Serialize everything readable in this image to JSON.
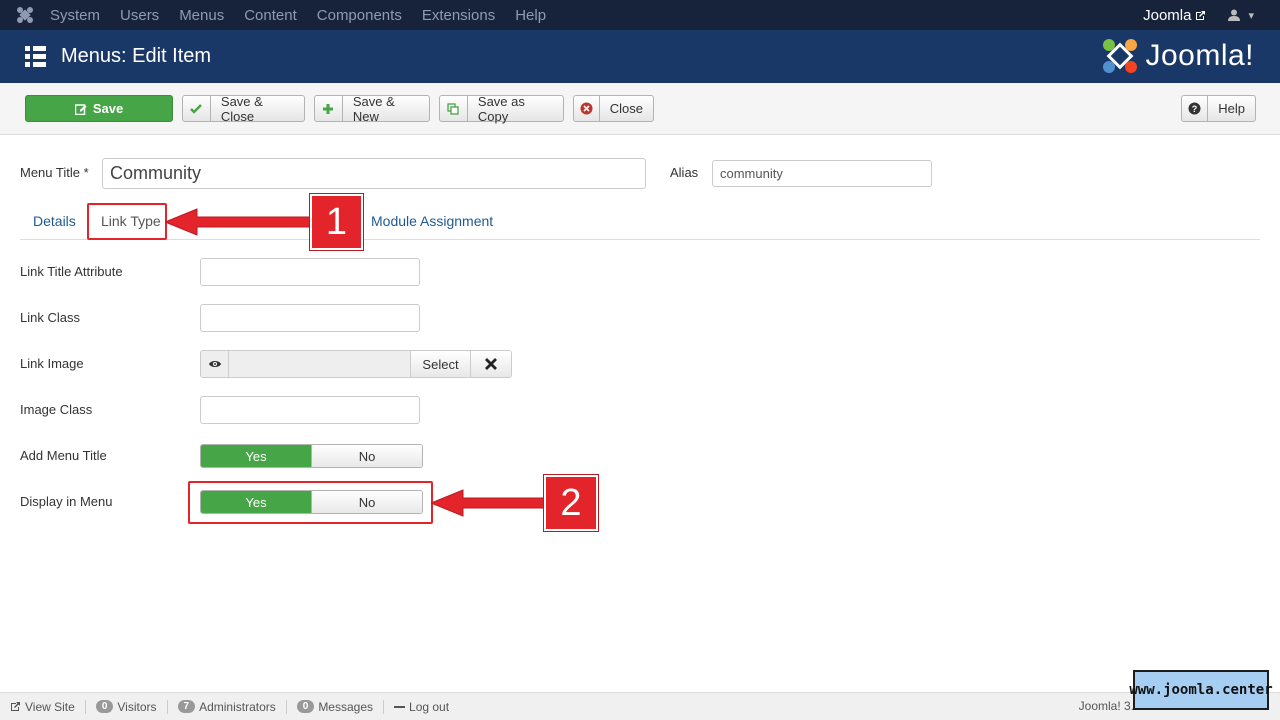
{
  "topnav": {
    "items": [
      "System",
      "Users",
      "Menus",
      "Content",
      "Components",
      "Extensions",
      "Help"
    ],
    "site_name": "Joomla"
  },
  "header": {
    "title": "Menus: Edit Item",
    "brand": "Joomla!"
  },
  "toolbar": {
    "save": "Save",
    "save_close": "Save & Close",
    "save_new": "Save & New",
    "save_copy": "Save as Copy",
    "close": "Close",
    "help": "Help"
  },
  "form": {
    "menu_title_label": "Menu Title *",
    "menu_title_value": "Community",
    "alias_label": "Alias",
    "alias_value": "community"
  },
  "tabs": {
    "details": "Details",
    "link_type": "Link Type",
    "module_assignment": "Module Assignment"
  },
  "fields": {
    "link_title_attribute": "Link Title Attribute",
    "link_class": "Link Class",
    "link_image": "Link Image",
    "select": "Select",
    "image_class": "Image Class",
    "add_menu_title": "Add Menu Title",
    "display_in_menu": "Display in Menu",
    "yes": "Yes",
    "no": "No"
  },
  "annotations": {
    "one": "1",
    "two": "2"
  },
  "footer": {
    "view_site": "View Site",
    "visitors_count": "0",
    "visitors": "Visitors",
    "admins_count": "7",
    "admins": "Administrators",
    "messages_count": "0",
    "messages": "Messages",
    "logout": "Log out",
    "version": "Joomla! 3.",
    "watermark": "www.joomla.center"
  },
  "colors": {
    "topnav": "#17233b",
    "header": "#1a3867",
    "green": "#46a546",
    "annotation_red": "#e3242b"
  }
}
